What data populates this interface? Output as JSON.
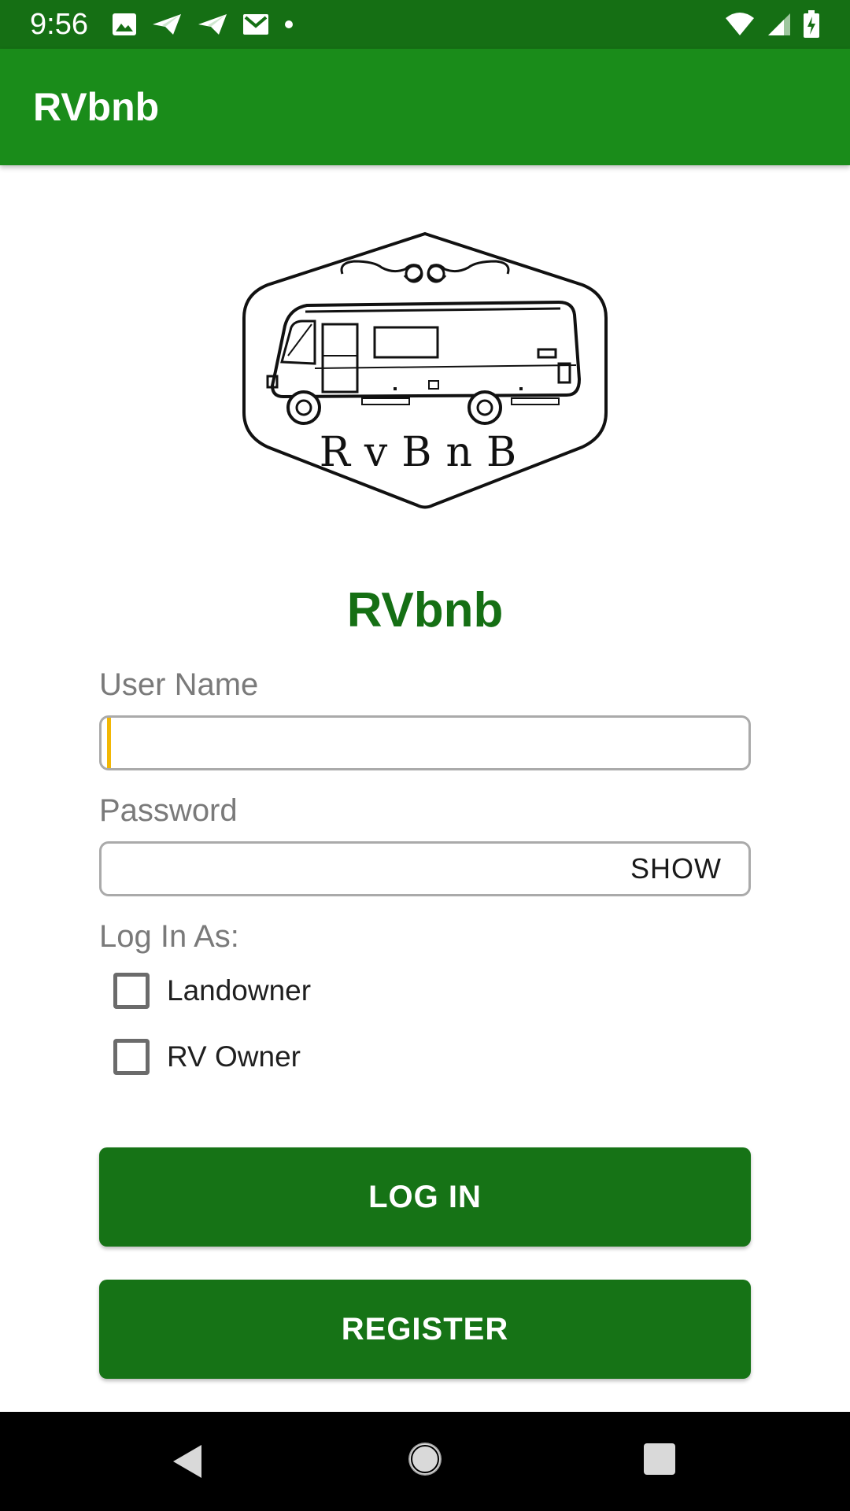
{
  "status_bar": {
    "time": "9:56",
    "left_icons": [
      "image-icon",
      "send-icon",
      "send-icon",
      "gmail-icon",
      "dot-icon"
    ],
    "right_icons": [
      "wifi-icon",
      "signal-icon",
      "battery-charging-icon"
    ]
  },
  "app_bar": {
    "title": "RVbnb"
  },
  "logo": {
    "text": "RvBnB"
  },
  "brand": {
    "title": "RVbnb"
  },
  "form": {
    "username": {
      "label": "User Name",
      "value": ""
    },
    "password": {
      "label": "Password",
      "value": "",
      "toggle_label": "SHOW"
    },
    "login_as": {
      "label": "Log In As:",
      "options": [
        {
          "label": "Landowner",
          "checked": false
        },
        {
          "label": "RV Owner",
          "checked": false
        }
      ]
    }
  },
  "buttons": {
    "login": "LOG IN",
    "register": "REGISTER"
  },
  "colors": {
    "status_bar": "#156f14",
    "app_bar": "#1a8c1a",
    "primary": "#167316",
    "caret": "#f2b705"
  },
  "nav_bar": {
    "icons": [
      "back-icon",
      "home-icon",
      "recents-icon"
    ]
  }
}
